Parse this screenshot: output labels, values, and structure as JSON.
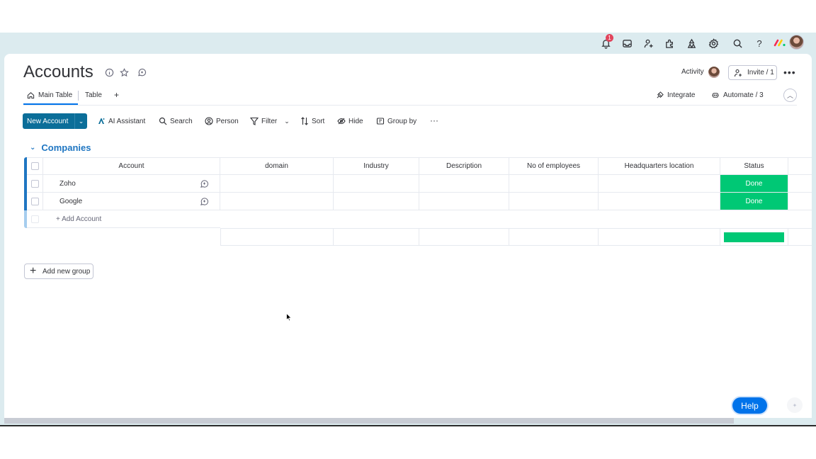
{
  "topbar": {
    "notifications_count": "1",
    "icons": [
      "bell-icon",
      "inbox-icon",
      "invite-members-icon",
      "apps-icon",
      "integrations-icon",
      "settings-icon",
      "search-icon",
      "help-icon"
    ]
  },
  "board": {
    "title": "Accounts",
    "activity_label": "Activity",
    "invite_label": "Invite / 1",
    "more_label": "•••",
    "tabs": [
      {
        "label": "Main Table"
      },
      {
        "label": "Table"
      },
      {
        "label": "+"
      }
    ],
    "integrate_label": "Integrate",
    "automate_label": "Automate / 3"
  },
  "toolbar": {
    "new_account_label": "New Account",
    "ai_assistant_label": "AI Assistant",
    "search_label": "Search",
    "person_label": "Person",
    "filter_label": "Filter",
    "sort_label": "Sort",
    "hide_label": "Hide",
    "group_by_label": "Group by",
    "more_label": "···"
  },
  "group": {
    "name": "Companies",
    "columns": [
      "Account",
      "domain",
      "Industry",
      "Description",
      "No of employees",
      "Headquarters location",
      "Status"
    ],
    "rows": [
      {
        "account": "Zoho",
        "status": "Done"
      },
      {
        "account": "Google",
        "status": "Done"
      }
    ],
    "add_item_label": "+ Add Account"
  },
  "add_group_label": "Add new group",
  "help_label": "Help",
  "colors": {
    "primary_blue": "#0073ea",
    "group_blue": "#1f76c2",
    "new_button": "#0b6e99",
    "status_done": "#00c875",
    "notification_red": "#e2445c"
  }
}
